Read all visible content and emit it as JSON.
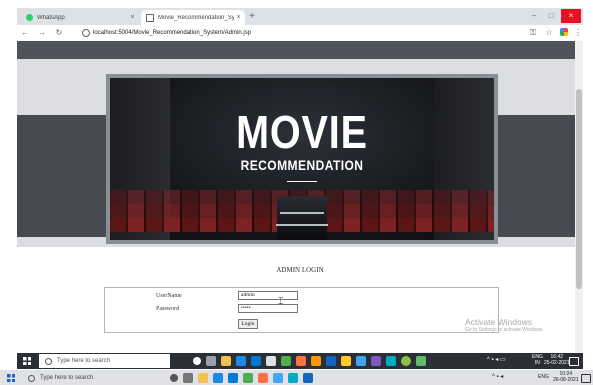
{
  "browser": {
    "tabs": [
      {
        "title": "WhatsApp",
        "active": false
      },
      {
        "title": "Movie_Recommendation_System",
        "active": true
      }
    ],
    "new_tab_glyph": "+",
    "close_glyph": "×",
    "url": "localhost:5004/Movie_Recommendation_System/Admin.jsp",
    "window_controls": {
      "minimize": "–",
      "maximize": "□",
      "close": "×"
    }
  },
  "banner": {
    "title": "MOVIE",
    "subtitle": "RECOMMENDATION"
  },
  "login": {
    "heading": "ADMIN LOGIN",
    "username_label": "UserName",
    "password_label": "Password",
    "username_value": "admin",
    "password_value": "•••••",
    "button_label": "Login"
  },
  "watermark": {
    "line1": "Activate Windows",
    "line2": "Go to Settings to activate Windows."
  },
  "taskbar": {
    "search_placeholder": "Type here to search",
    "lang_top": "ENG",
    "lang_bottom": "IN",
    "time": "16:42",
    "date": "25-02-2021"
  },
  "host_taskbar": {
    "search_placeholder": "Type here to search",
    "lang": "ENG",
    "time": "10:24",
    "date": "26-08-2021"
  },
  "colors": {
    "page_light_band": "#dcdde0",
    "page_dark_band": "#464a51",
    "banner_frame": "#8a8f96",
    "seat_red": "#7c2224",
    "taskbar": "#2b2f38"
  }
}
